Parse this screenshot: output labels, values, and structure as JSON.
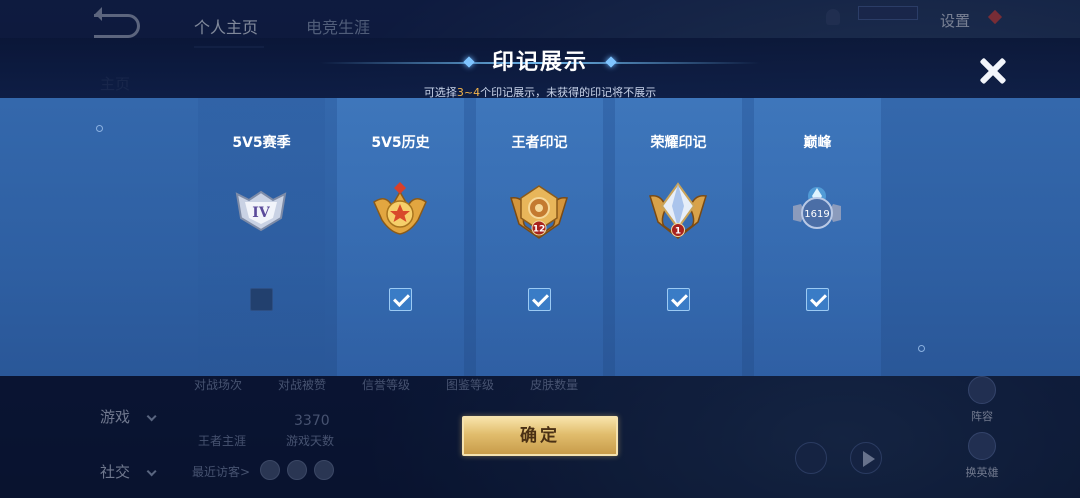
{
  "background": {
    "tabs": [
      "个人主页",
      "电竞生涯"
    ],
    "sidebar": [
      "主页",
      "游戏",
      "社交"
    ],
    "settings_label": "设置",
    "stats_labels": [
      "对战场次",
      "对战被赞",
      "信誉等级",
      "图鉴等级",
      "皮肤数量"
    ],
    "stat_main": "王者主涯",
    "stat_value": "3370",
    "stat_value_label": "游戏天数",
    "visitors_label": "最近访客>",
    "right_buttons": [
      "阵容",
      "换英雄"
    ]
  },
  "modal": {
    "title": "印记展示",
    "subtitle_pre": "可选择",
    "subtitle_highlight": "3~4",
    "subtitle_post": "个印记展示，未获得的印记将不展示",
    "confirm_label": "确定",
    "cards": [
      {
        "label": "5V5赛季",
        "badge_text": "IV",
        "badge_icon": "silver-rank-badge",
        "checked": false
      },
      {
        "label": "5V5历史",
        "badge_text": "",
        "badge_icon": "gold-star-badge",
        "checked": true
      },
      {
        "label": "王者印记",
        "badge_text": "12",
        "badge_icon": "king-mark-badge",
        "checked": true
      },
      {
        "label": "荣耀印记",
        "badge_text": "1",
        "badge_icon": "glory-diamond-badge",
        "checked": true
      },
      {
        "label": "巅峰",
        "badge_text": "1619",
        "badge_icon": "peak-badge",
        "checked": true
      }
    ]
  },
  "colors": {
    "panel": "#2e5fa2",
    "highlight": "#f2b34a",
    "confirm": "#e1bd6d"
  }
}
